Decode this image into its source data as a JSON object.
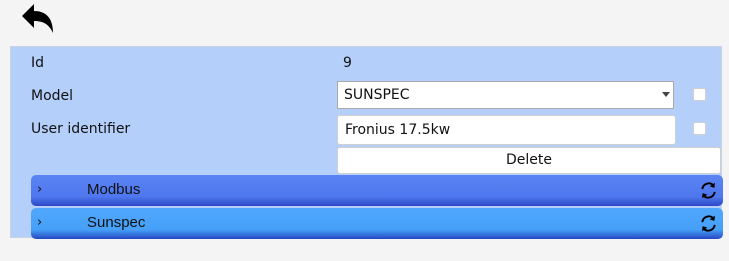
{
  "back_icon": "undo-arrow-icon",
  "fields": {
    "id": {
      "label": "Id",
      "value": "9"
    },
    "model": {
      "label": "Model",
      "value": "SUNSPEC"
    },
    "user_identifier": {
      "label": "User identifier",
      "value": "Fronius 17.5kw"
    }
  },
  "delete_label": "Delete",
  "sections": [
    {
      "chevron": "›",
      "title": "Modbus",
      "icon": "refresh-icon",
      "color": "#4f77ee"
    },
    {
      "chevron": "›",
      "title": "Sunspec",
      "icon": "refresh-icon",
      "color": "#46a0f8"
    }
  ],
  "colors": {
    "panel_background": "#b3cffa",
    "page_background": "#f4f4f4"
  }
}
